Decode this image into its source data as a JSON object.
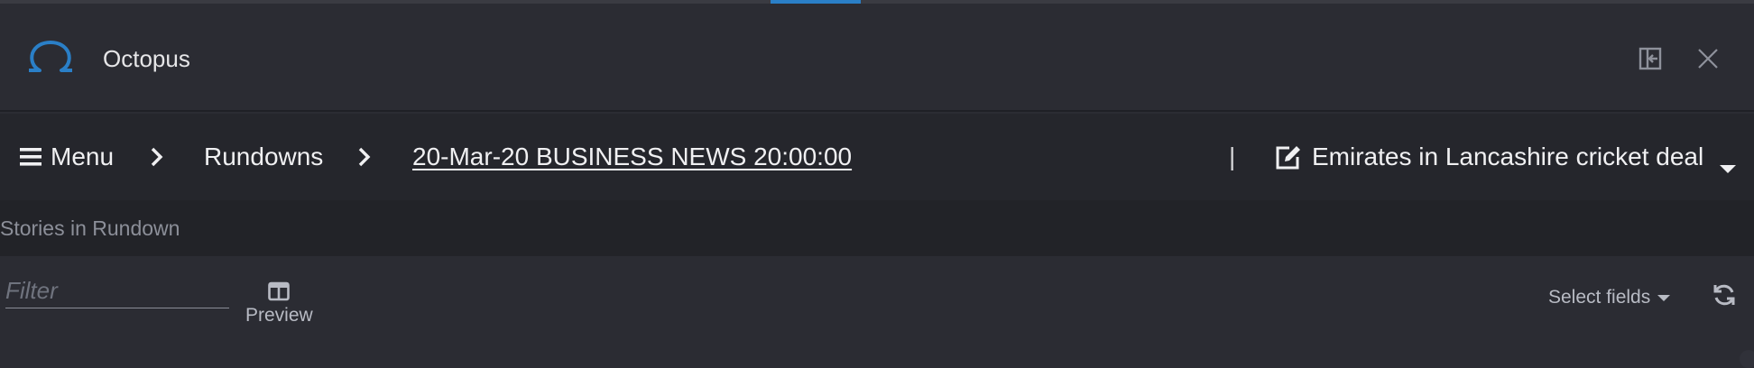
{
  "header": {
    "app_title": "Octopus",
    "logo_icon": "omega-logo-icon",
    "actions": [
      "dock-panel-icon",
      "close-icon"
    ]
  },
  "breadcrumb": {
    "menu_label": "Menu",
    "items": [
      {
        "label": "Rundowns"
      },
      {
        "label": "20-Mar-20 BUSINESS NEWS 20:00:00"
      }
    ],
    "separator": "|",
    "story_title": "Emirates in Lancashire cricket deal"
  },
  "section": {
    "title": "Stories in Rundown"
  },
  "toolbar": {
    "filter_placeholder": "Filter",
    "preview_label": "Preview",
    "select_fields_label": "Select fields"
  },
  "colors": {
    "accent": "#2a7fc7",
    "background": "#2b2c33",
    "breadcrumb_bg": "#25262c",
    "section_bg": "#222328"
  }
}
